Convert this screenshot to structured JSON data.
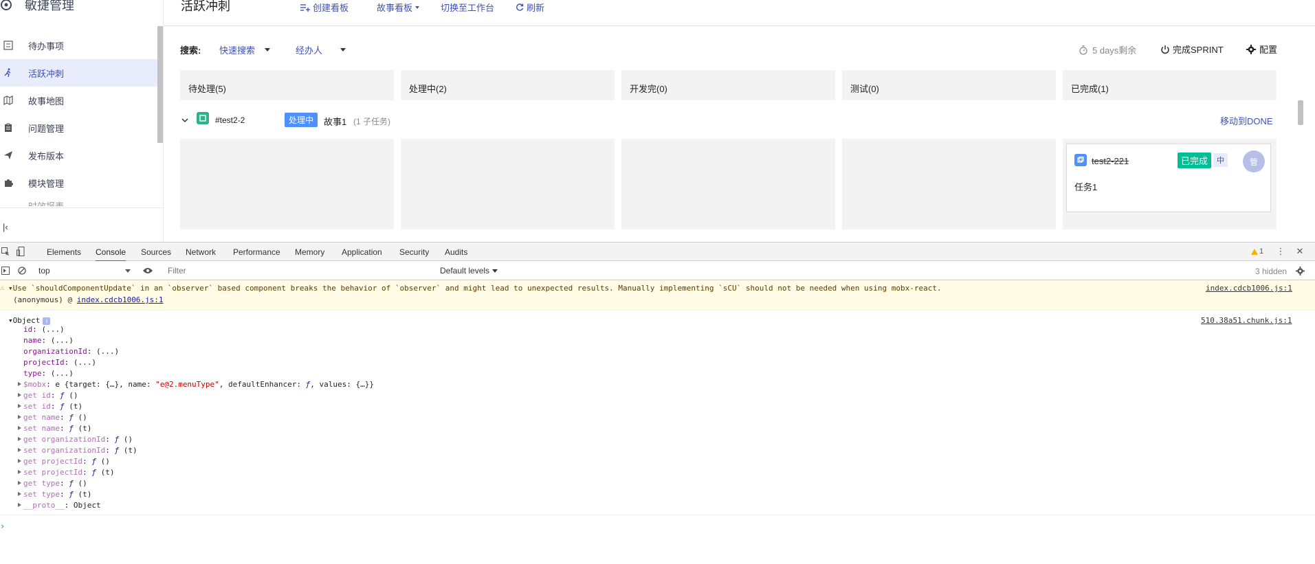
{
  "sidebar": {
    "title": "敏捷管理",
    "items": [
      {
        "label": "待办事项",
        "icon": "list-icon",
        "active": false
      },
      {
        "label": "活跃冲刺",
        "icon": "run-icon",
        "active": true
      },
      {
        "label": "故事地图",
        "icon": "map-icon",
        "active": false
      },
      {
        "label": "问题管理",
        "icon": "clipboard-icon",
        "active": false
      },
      {
        "label": "发布版本",
        "icon": "send-icon",
        "active": false
      },
      {
        "label": "模块管理",
        "icon": "puzzle-icon",
        "active": false
      }
    ],
    "partial_item": "时效报表",
    "collapse_icon": "collapse-left-icon"
  },
  "header": {
    "title": "活跃冲刺",
    "create_board": "创建看板",
    "story_board": "故事看板",
    "switch_workbench": "切换至工作台",
    "refresh": "刷新"
  },
  "search": {
    "label": "搜索:",
    "quick_search": "快速搜索",
    "assignee": "经办人",
    "remaining": "5 days剩余",
    "complete_sprint": "完成SPRINT",
    "config": "配置"
  },
  "board": {
    "columns": [
      "待处理(5)",
      "处理中(2)",
      "开发完(0)",
      "测试(0)",
      "已完成(1)"
    ],
    "swimlane": {
      "id": "#test2-2",
      "status": "处理中",
      "name": "故事1",
      "subtasks": "(1 子任务)",
      "move": "移动到DONE"
    },
    "card": {
      "id": "test2-221",
      "status": "已完成",
      "priority": "中",
      "avatar": "管",
      "description": "任务1"
    },
    "colors": {
      "accent": "#3f51b5",
      "status_doing": "#4d90fe",
      "status_done": "#00bf96",
      "story_icon": "#2fb18a"
    }
  },
  "devtools": {
    "tabs": [
      "Elements",
      "Console",
      "Sources",
      "Network",
      "Performance",
      "Memory",
      "Application",
      "Security",
      "Audits"
    ],
    "active_tab": "Console",
    "warning_count": "1",
    "context": "top",
    "filter_placeholder": "Filter",
    "levels": "Default levels",
    "hidden": "3 hidden",
    "warning": {
      "message": "Use `shouldComponentUpdate` in an `observer` based component breaks the behavior of `observer` and might lead to unexpected results. Manually implementing `sCU` should not be needed when using mobx-react.",
      "trace_prefix": "(anonymous) @ ",
      "trace_link": "index.cdcb1006.js:1",
      "source": "index.cdcb1006.js:1"
    },
    "object_log": {
      "label": "Object",
      "source": "510.38a51.chunk.js:1",
      "lazy_props": [
        {
          "key": "id",
          "value": "(...)"
        },
        {
          "key": "name",
          "value": "(...)"
        },
        {
          "key": "organizationId",
          "value": "(...)"
        },
        {
          "key": "projectId",
          "value": "(...)"
        },
        {
          "key": "type",
          "value": "(...)"
        }
      ],
      "mobx": {
        "key": "$mobx",
        "pre": "e {target: {…}, name: ",
        "str": "\"e@2.menuType\"",
        "mid": ", defaultEnhancer: ",
        "f": "ƒ",
        "post": ", values: {…}}"
      },
      "accessors": [
        {
          "key": "get id",
          "sig": "()"
        },
        {
          "key": "set id",
          "sig": "(t)"
        },
        {
          "key": "get name",
          "sig": "()"
        },
        {
          "key": "set name",
          "sig": "(t)"
        },
        {
          "key": "get organizationId",
          "sig": "()"
        },
        {
          "key": "set organizationId",
          "sig": "(t)"
        },
        {
          "key": "get projectId",
          "sig": "()"
        },
        {
          "key": "set projectId",
          "sig": "(t)"
        },
        {
          "key": "get type",
          "sig": "()"
        },
        {
          "key": "set type",
          "sig": "(t)"
        }
      ],
      "proto": {
        "key": "__proto__",
        "value": "Object"
      }
    },
    "prompt": "›"
  }
}
